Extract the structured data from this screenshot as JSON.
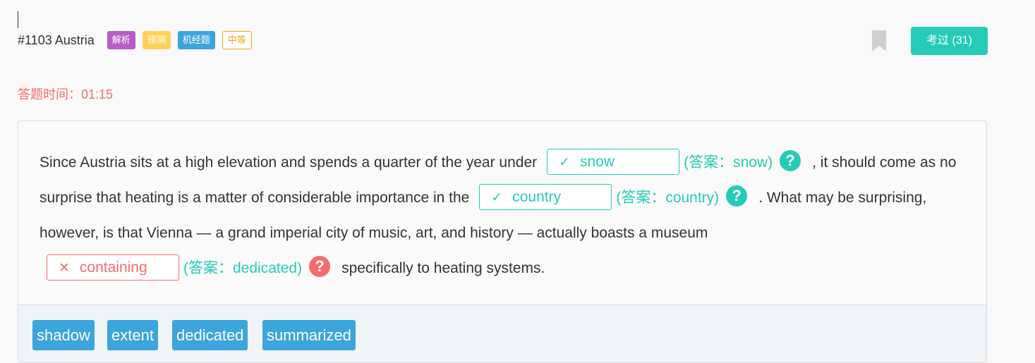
{
  "header": {
    "question_title": "#1103 Austria",
    "tags": [
      "解析",
      "预测",
      "机经题",
      "中等"
    ],
    "done_button": "考过 (31)"
  },
  "timer": {
    "label": "答题时间：01:15"
  },
  "passage": {
    "segment_1": "Since Austria sits at a high elevation and spends a quarter of the year under",
    "blank_1": {
      "value": "snow",
      "status": "correct",
      "answer": "(答案：snow)"
    },
    "segment_2": ", it should come as no surprise that heating is a matter of considerable importance in the",
    "blank_2": {
      "value": "country",
      "status": "correct",
      "answer": "(答案：country)"
    },
    "segment_3": ". What may be surprising, however, is that Vienna — a grand imperial city of music, art, and history — actually boasts a museum",
    "blank_3": {
      "value": "containing",
      "status": "wrong",
      "answer": "(答案：dedicated)"
    },
    "segment_4": "specifically to heating systems."
  },
  "word_bank": [
    "shadow",
    "extent",
    "dedicated",
    "summarized"
  ],
  "icons": {
    "correct": "✓",
    "wrong": "✕",
    "help": "?",
    "bookmark": "bookmark-icon"
  },
  "colors": {
    "accent": "#26cbb8",
    "error": "#f56c6c",
    "word_chip": "#3ba5dc",
    "tag_purple": "#b85cc8",
    "tag_yellow": "#ffd15c",
    "tag_blue": "#3ba5dc",
    "tag_outline": "#f0a020"
  }
}
